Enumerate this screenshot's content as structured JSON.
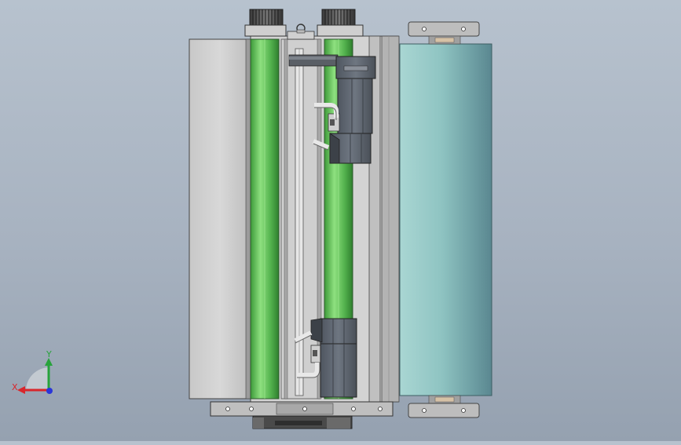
{
  "viewport": {
    "name": "cad-graphics-area",
    "background_top": "#b7c2ce",
    "background_bottom": "#95a1b0"
  },
  "model": {
    "roller_color": "#5fbf5a",
    "roller_highlight": "#8ee07f",
    "film_roll_color": "#7fb9b9",
    "frame_color": "#c9c9c9",
    "motor_color": "#5f6670"
  },
  "triad": {
    "x_label": "X",
    "y_label": "Y",
    "x_color": "#d9262c",
    "y_color": "#27a33b",
    "z_color": "#2a36d8"
  }
}
